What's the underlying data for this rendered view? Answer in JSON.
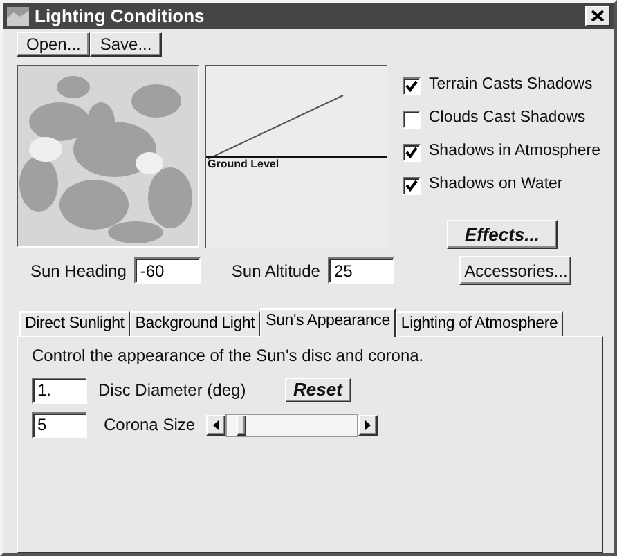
{
  "window": {
    "title": "Lighting Conditions"
  },
  "toolbar": [
    "Open...",
    "Save..."
  ],
  "graph": {
    "label": "Ground Level"
  },
  "options": [
    {
      "label": "Terrain Casts Shadows",
      "checked": true
    },
    {
      "label": "Clouds Cast Shadows",
      "checked": false
    },
    {
      "label": "Shadows in Atmosphere",
      "checked": true
    },
    {
      "label": "Shadows on Water",
      "checked": true
    }
  ],
  "effects_button": "Effects...",
  "sun_heading": {
    "label": "Sun Heading",
    "value": "-60"
  },
  "sun_altitude": {
    "label": "Sun Altitude",
    "value": "25"
  },
  "accessories_button": "Accessories...",
  "tabs": [
    {
      "label": "Direct Sunlight",
      "selected": false
    },
    {
      "label": "Background Light",
      "selected": false
    },
    {
      "label": "Sun's Appearance",
      "selected": true
    },
    {
      "label": "Lighting of Atmosphere",
      "selected": false
    }
  ],
  "panel": {
    "description": "Control the appearance of the Sun's disc and corona.",
    "disc_diameter": {
      "value": "1.",
      "label": "Disc Diameter (deg)"
    },
    "reset_button": "Reset",
    "corona_size": {
      "value": "5",
      "label": "Corona Size",
      "level": 0.08
    }
  }
}
